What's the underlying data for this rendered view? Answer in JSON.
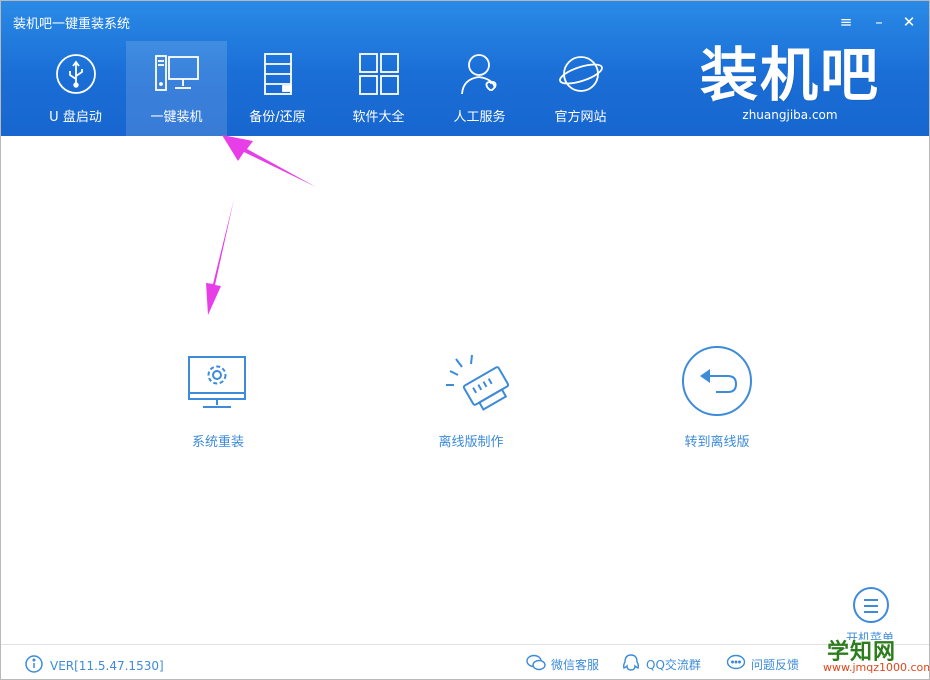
{
  "window": {
    "title": "装机吧一键重装系统",
    "controls": {
      "menu": "≡",
      "minimize": "–",
      "close": "✕"
    }
  },
  "nav": {
    "items": [
      {
        "label": "U 盘启动",
        "icon": "usb-icon"
      },
      {
        "label": "一键装机",
        "icon": "desktop-pc-icon",
        "active": true
      },
      {
        "label": "备份/还原",
        "icon": "server-icon"
      },
      {
        "label": "软件大全",
        "icon": "apps-grid-icon"
      },
      {
        "label": "人工服务",
        "icon": "person-heart-icon"
      },
      {
        "label": "官方网站",
        "icon": "planet-icon"
      }
    ]
  },
  "logo": {
    "main": "装机吧",
    "sub": "zhuangjiba.com"
  },
  "features": [
    {
      "label": "系统重装",
      "icon": "monitor-gear-icon"
    },
    {
      "label": "离线版制作",
      "icon": "flash-drive-icon"
    },
    {
      "label": "转到离线版",
      "icon": "back-arrow-circle-icon"
    }
  ],
  "menu_button": {
    "label": "开机菜单"
  },
  "footer": {
    "version": "VER[11.5.47.1530]",
    "links": [
      {
        "label": "微信客服",
        "icon": "wechat-icon"
      },
      {
        "label": "QQ交流群",
        "icon": "qq-icon"
      },
      {
        "label": "问题反馈",
        "icon": "chat-bubble-icon"
      }
    ]
  },
  "watermark": {
    "main": "学知网",
    "sub": "www.jmqz1000.com"
  },
  "colors": {
    "header": "#1a6ed6",
    "accent": "#3d8bd9",
    "arrow": "#e83ee8"
  }
}
